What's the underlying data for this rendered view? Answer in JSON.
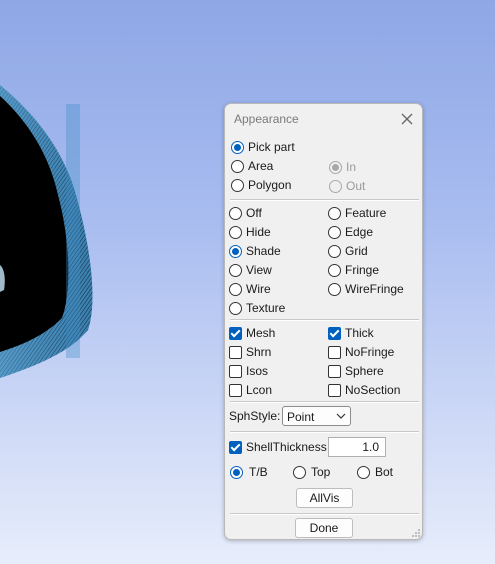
{
  "dialog": {
    "title": "Appearance",
    "close_icon": "close-icon",
    "pick": {
      "pick_part": "Pick part",
      "area": "Area",
      "polygon": "Polygon",
      "in": "In",
      "out": "Out",
      "selected": "Pick part",
      "scope_selected": "In"
    },
    "display": {
      "left": [
        "Off",
        "Hide",
        "Shade",
        "View",
        "Wire",
        "Texture"
      ],
      "right": [
        "Feature",
        "Edge",
        "Grid",
        "Fringe",
        "WireFringe"
      ],
      "selected": "Shade"
    },
    "options": {
      "mesh": "Mesh",
      "thick": "Thick",
      "shrn": "Shrn",
      "nofringe": "NoFringe",
      "isos": "Isos",
      "sphere": "Sphere",
      "lcon": "Lcon",
      "nosection": "NoSection",
      "checked": [
        "Mesh",
        "Thick"
      ]
    },
    "sph_style": {
      "label": "SphStyle:",
      "value": "Point"
    },
    "shell": {
      "label": "ShellThickness",
      "checked": true,
      "value": "1.0",
      "tb": "T/B",
      "top": "Top",
      "bot": "Bot",
      "selected": "T/B"
    },
    "allvis_label": "AllVis",
    "done_label": "Done"
  },
  "colors": {
    "accent": "#0060c0",
    "mesh_blue": "#2f6f9a",
    "background_top": "#8fa7e6",
    "background_bottom": "#e7edfb"
  }
}
